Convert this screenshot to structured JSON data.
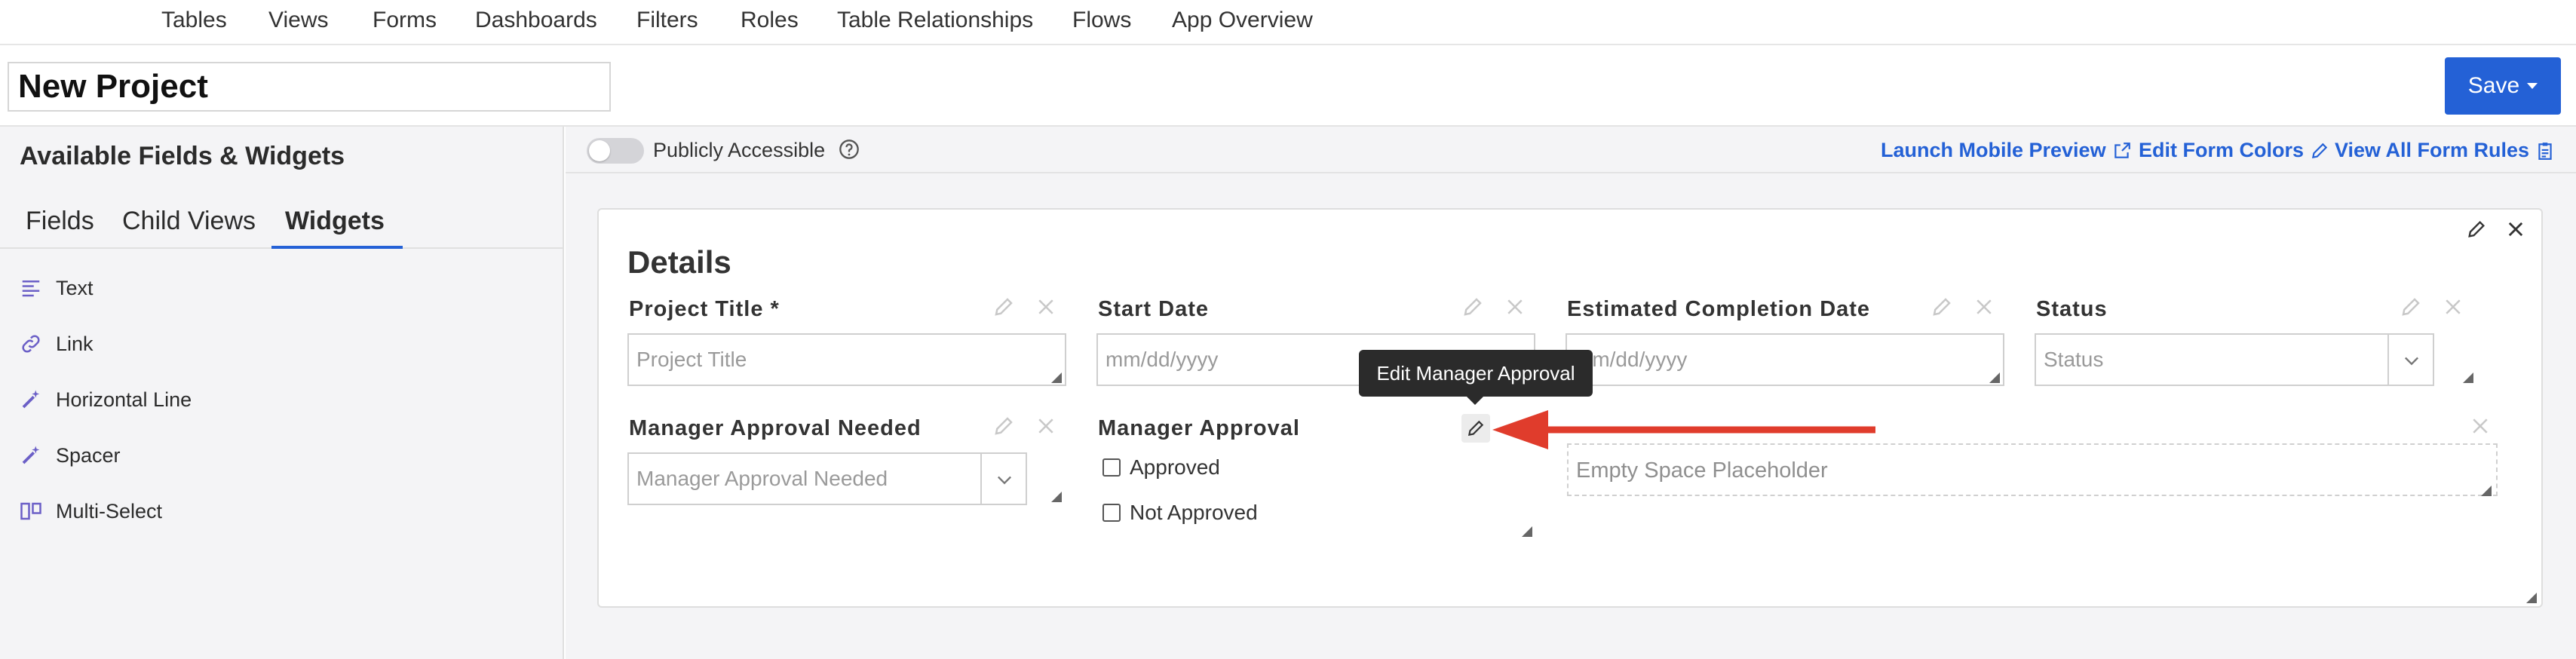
{
  "nav": {
    "items": [
      "Tables",
      "Views",
      "Forms",
      "Dashboards",
      "Filters",
      "Roles",
      "Table Relationships",
      "Flows",
      "App Overview"
    ]
  },
  "header": {
    "title": "New Project",
    "save_label": "Save"
  },
  "sidebar": {
    "heading": "Available Fields & Widgets",
    "tabs": [
      "Fields",
      "Child Views",
      "Widgets"
    ],
    "active_tab": "Widgets",
    "widgets": [
      {
        "label": "Text",
        "icon": "align-left-icon"
      },
      {
        "label": "Link",
        "icon": "link-icon"
      },
      {
        "label": "Horizontal Line",
        "icon": "magic-wand-icon"
      },
      {
        "label": "Spacer",
        "icon": "magic-wand-icon"
      },
      {
        "label": "Multi-Select",
        "icon": "columns-icon"
      }
    ]
  },
  "toolbar": {
    "public_label": "Publicly Accessible",
    "public_on": false,
    "links": [
      "Launch Mobile Preview",
      "Edit Form Colors",
      "View All Form Rules"
    ]
  },
  "form": {
    "section_title": "Details",
    "fields": {
      "project_title": {
        "label": "Project Title *",
        "placeholder": "Project Title"
      },
      "start_date": {
        "label": "Start Date",
        "placeholder": "mm/dd/yyyy"
      },
      "est_completion": {
        "label": "Estimated Completion Date",
        "placeholder": "mm/dd/yyyy"
      },
      "status": {
        "label": "Status",
        "placeholder": "Status"
      },
      "manager_needed": {
        "label": "Manager Approval Needed",
        "placeholder": "Manager Approval Needed"
      },
      "manager_approval": {
        "label": "Manager Approval",
        "options": [
          "Approved",
          "Not Approved"
        ]
      }
    },
    "empty_placeholder": "Empty Space Placeholder"
  },
  "tooltip": {
    "text": "Edit Manager Approval"
  },
  "colors": {
    "accent": "#2461d6",
    "annotation_arrow": "#e03c2c",
    "widget_icon": "#6b5fc7"
  }
}
